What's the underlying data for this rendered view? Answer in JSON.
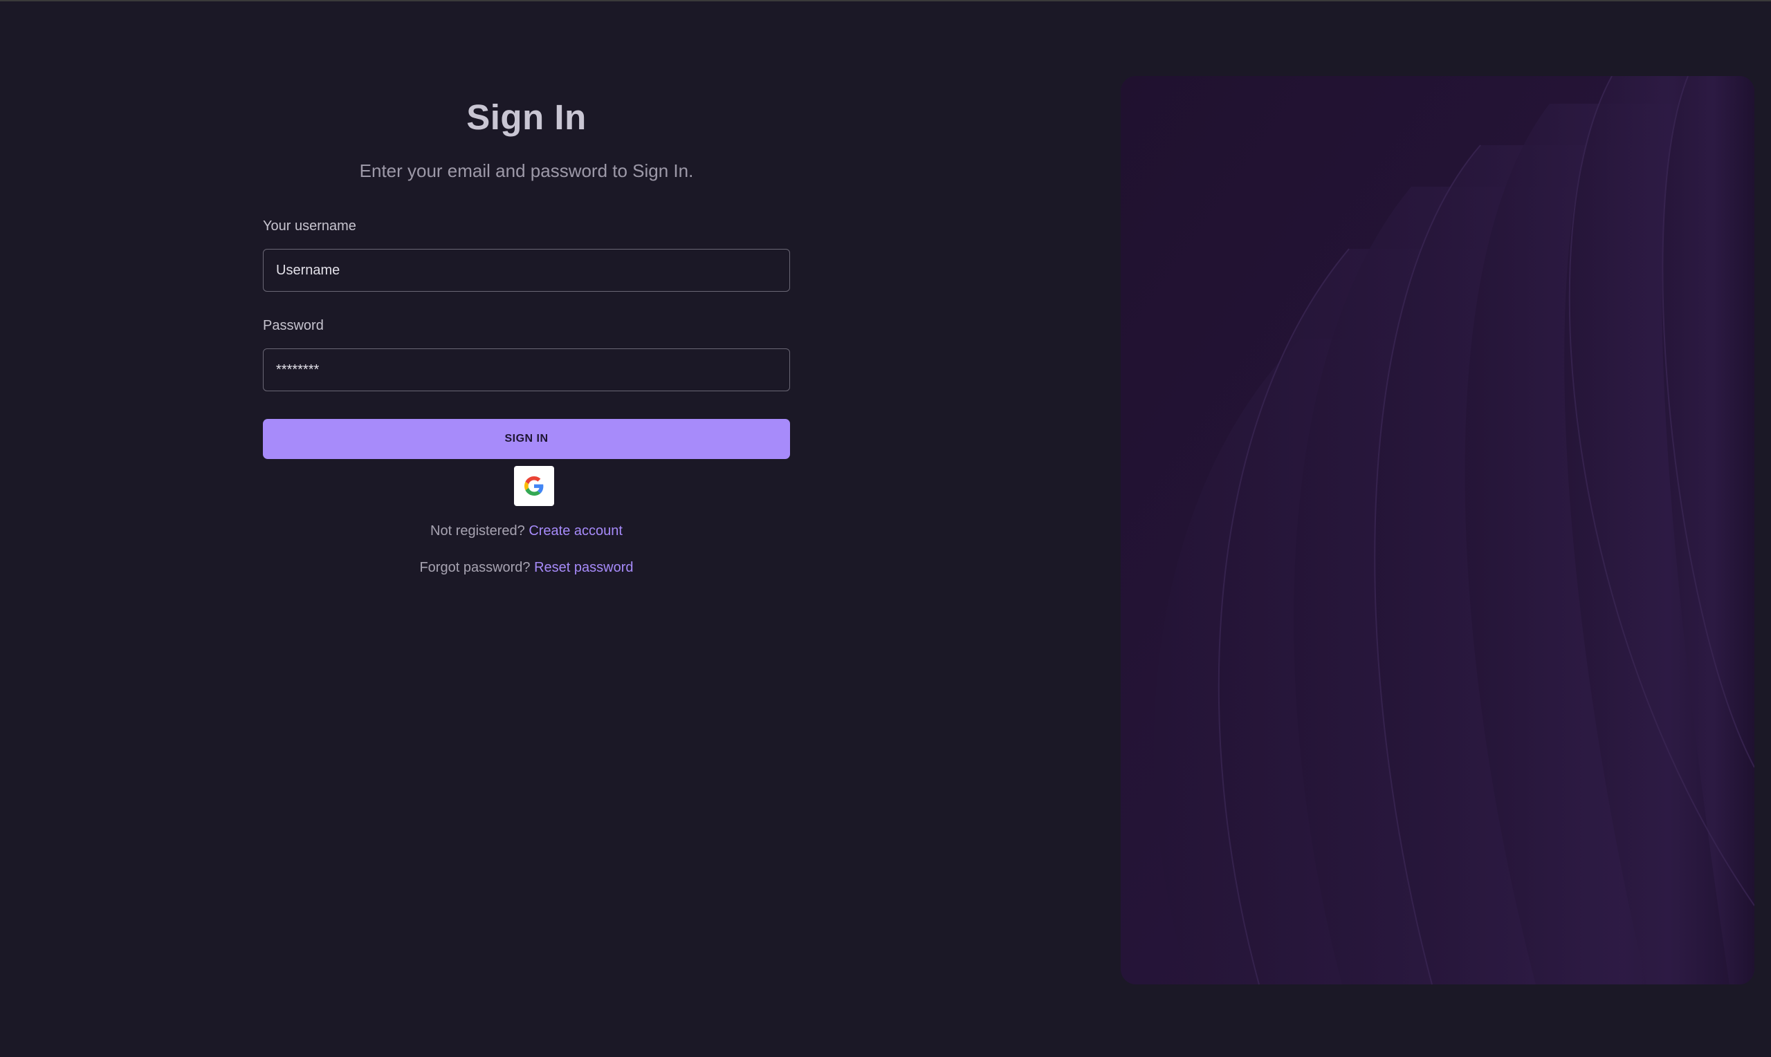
{
  "signin": {
    "title": "Sign In",
    "subtitle": "Enter your email and password to Sign In.",
    "username_label": "Your username",
    "username_placeholder": "Username",
    "password_label": "Password",
    "password_value": "********",
    "signin_button": "Sign In",
    "google_icon": "google-icon",
    "not_registered_text": "Not registered?",
    "create_account_link": "Create account",
    "forgot_password_text": "Forgot password?",
    "reset_password_link": "Reset password"
  },
  "theme": {
    "background": "#1b1826",
    "accent": "#a78bfa",
    "panel": "#231437"
  }
}
